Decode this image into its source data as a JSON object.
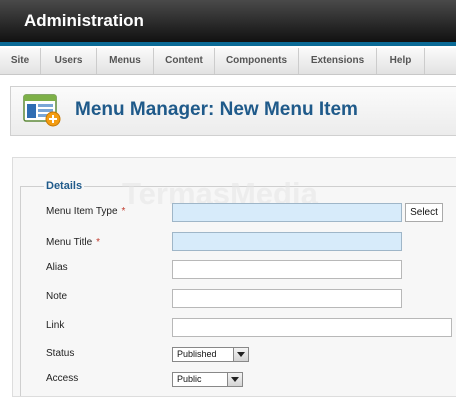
{
  "header": {
    "title": "Administration"
  },
  "menubar": {
    "items": [
      "Site",
      "Users",
      "Menus",
      "Content",
      "Components",
      "Extensions",
      "Help"
    ]
  },
  "toolbar": {
    "title": "Menu Manager: New Menu Item",
    "icon": "menu-manager-add-icon"
  },
  "watermark": "TermasMedia",
  "form": {
    "legend": "Details",
    "required_marker": "*",
    "fields": {
      "menu_item_type": {
        "label": "Menu Item Type",
        "value": "",
        "required": true,
        "button": "Select"
      },
      "menu_title": {
        "label": "Menu Title",
        "value": "",
        "required": true
      },
      "alias": {
        "label": "Alias",
        "value": ""
      },
      "note": {
        "label": "Note",
        "value": ""
      },
      "link": {
        "label": "Link",
        "value": ""
      },
      "status": {
        "label": "Status",
        "value": "Published"
      },
      "access": {
        "label": "Access",
        "value": "Public"
      }
    }
  },
  "colors": {
    "accent": "#1f5a8a",
    "header_border": "#0a6a96",
    "required_field": "#d7ebfa",
    "required_marker": "#c0392b"
  }
}
